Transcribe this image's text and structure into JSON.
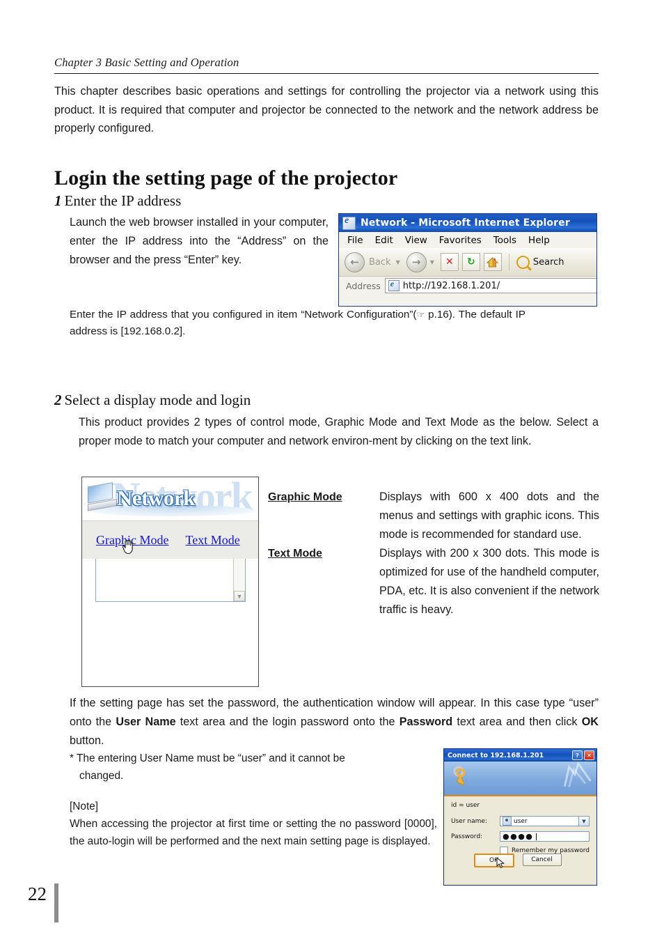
{
  "document": {
    "chapter_head": "Chapter 3 Basic Setting and Operation",
    "intro": "This chapter describes basic operations and settings for controlling the projector via a network using this product. It is required that computer and projector be connected to the network and the network address be properly configured.",
    "title": "Login the setting page of the projector",
    "page_number": "22"
  },
  "step1": {
    "number": "1",
    "heading": "Enter the IP address",
    "body": "Launch the web browser installed in your computer, enter the IP address into the “Address” on the browser and the press “Enter” key.",
    "note_part1": "Enter the IP address that you configured in item “Network Configuration”(",
    "note_hand": "☞",
    "note_part2": " p.16). The default IP address is [192.168.0.2]."
  },
  "step2": {
    "number": "2",
    "heading": "Select a display mode and login",
    "body": "This product provides 2 types of control mode, Graphic Mode and Text Mode as the below. Select a proper mode to match your computer and network environ-ment by clicking on the text link."
  },
  "browser_window": {
    "title": "Network - Microsoft Internet Explorer",
    "menu_items": [
      "File",
      "Edit",
      "View",
      "Favorites",
      "Tools",
      "Help"
    ],
    "toolbar": {
      "back_label": "Back",
      "back_icon": "arrow-left-icon",
      "forward_icon": "arrow-right-icon",
      "stop_icon": "stop-icon",
      "stop_glyph": "✕",
      "refresh_icon": "refresh-icon",
      "refresh_glyph": "↻",
      "home_icon": "home-icon",
      "home_glyph": "⌂",
      "search_label": "Search"
    },
    "address": {
      "label": "Address",
      "value": "http://192.168.1.201/"
    }
  },
  "network_page": {
    "wordmark": "Network",
    "watermark": "Network",
    "links": [
      {
        "label": "Graphic Mode"
      },
      {
        "label": "Text Mode"
      }
    ]
  },
  "modes": [
    {
      "name": "Graphic Mode",
      "description": "Displays with 600 x 400 dots and the menus and settings with graphic icons. This mode is recommended for standard use."
    },
    {
      "name": "Text Mode",
      "description": "Displays with 200 x 300 dots. This mode is optimized for use of the handheld computer, PDA, etc. It is also convenient if the network traffic is heavy."
    }
  ],
  "auth_text": {
    "para_1": "If the setting page has set the password, the authentication window will appear. In this case type “user” onto the ",
    "user_name_bold": "User Name",
    "para_2": " text area and the login password onto the ",
    "password_bold": "Password",
    "para_3": " text area and then click ",
    "ok_bold": "OK",
    "para_4": " button.",
    "star_note": "* The entering User Name must be “user” and it cannot be",
    "star_note_cont": "changed.",
    "note_head": "[Note]",
    "note_body": "When accessing the projector at first time or setting the no password [0000], the auto-login will be performed and the next main setting page is displayed."
  },
  "auth_dialog": {
    "title": "Connect to 192.168.1.201",
    "help_glyph": "?",
    "close_glyph": "✕",
    "keys_glyph": "⚷",
    "deco_glyph": "⌘",
    "id_line": "id = user",
    "user_name_label": "User name:",
    "user_name_value": "user",
    "password_label": "Password:",
    "password_value": "●●●●",
    "dropdown_glyph": "▼",
    "remember_label": "Remember my password",
    "ok_label": "OK",
    "cancel_label": "Cancel"
  },
  "colors": {
    "title_bar_blue": "#1550b8",
    "link_blue": "#1414d2",
    "focus_orange": "#e08a14",
    "page_bar_gray": "#8b8b8b"
  }
}
